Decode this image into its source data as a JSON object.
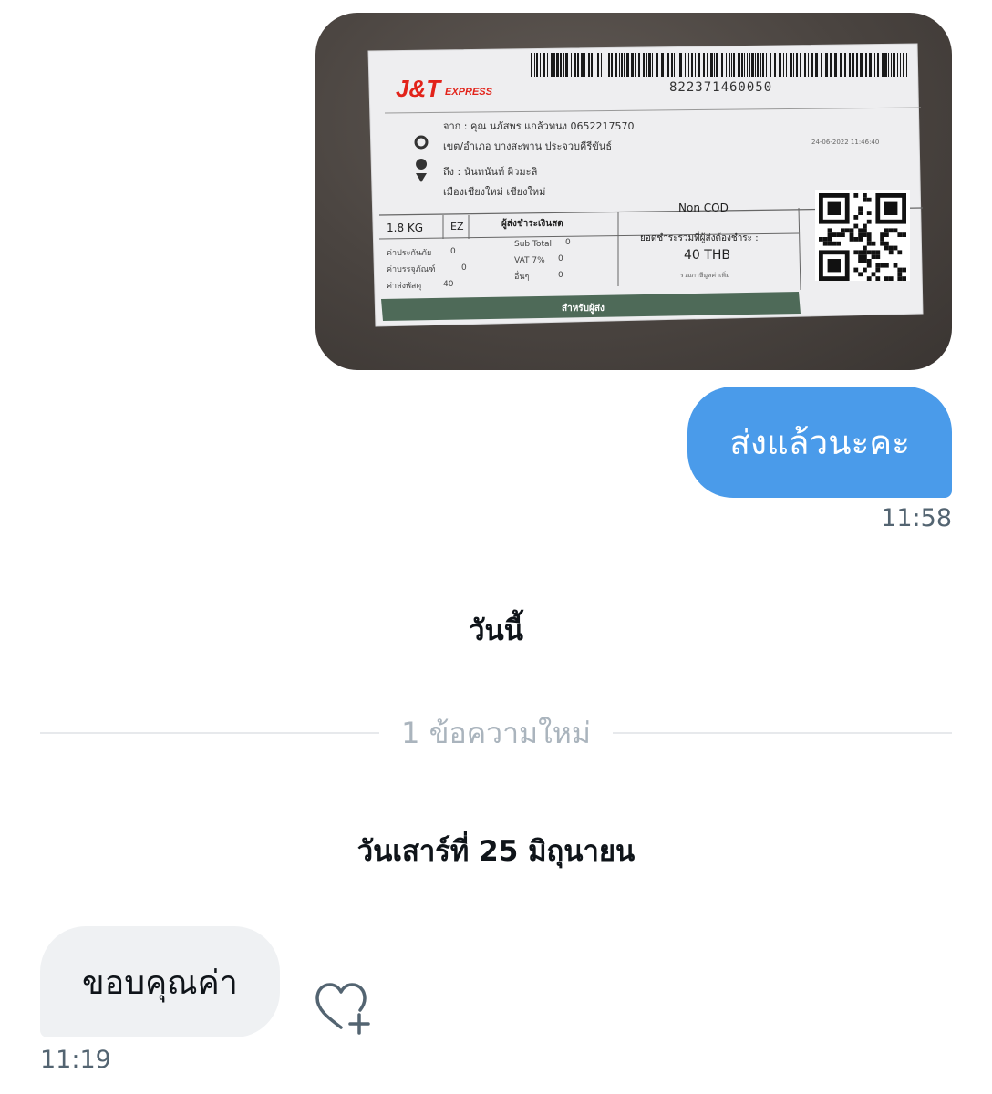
{
  "messages": {
    "outgoing_photo": {
      "label": {
        "brand_main": "J&T",
        "brand_sub": "EXPRESS",
        "tracking": "822371460050",
        "sender_line1": "จาก : คุณ นภัสพร แกล้วทนง 0652217570",
        "sender_line2": "เขต/อำเภอ บางสะพาน ประจวบคีรีขันธ์",
        "receiver_line1": "ถึง : นันทนันท์ ผิวมะลิ",
        "receiver_line2": "เมืองเชียงใหม่ เชียงใหม่",
        "date": "24-06-2022 11:46:40",
        "weight": "1.8 KG",
        "service": "EZ",
        "payer": "ผู้ส่งชำระเงินสด",
        "cod": "Non COD",
        "total_label": "ยอดชำระรวมที่ผู้ส่งต้องชำระ :",
        "total": "40 THB",
        "vat_note": "รวมภาษีมูลค่าเพิ่ม",
        "fee1_label": "ค่าประกันภัย",
        "fee1": "0",
        "fee2_label": "ค่าบรรจุภัณฑ์",
        "fee2": "0",
        "fee3_label": "ค่าส่งพัสดุ",
        "fee3": "40",
        "sub_total_label": "Sub Total",
        "sub_total": "0",
        "vat_label": "VAT 7%",
        "vat": "0",
        "other_label": "อื่นๆ",
        "other": "0",
        "footer": "สำหรับผู้ส่ง"
      }
    },
    "outgoing_text": "ส่งแล้วนะคะ",
    "outgoing_time": "11:58",
    "date_today": "วันนี้",
    "new_messages": "1 ข้อความใหม่",
    "date_saturday": "วันเสาร์ที่ 25 มิถุนายน",
    "incoming_text": "ขอบคุณค่า",
    "incoming_time": "11:19"
  },
  "colors": {
    "outgoing_bubble": "#4a9bea",
    "incoming_bubble": "#eff1f3",
    "jt_red": "#e2231a"
  },
  "icons": {
    "reaction": "heart-plus-icon"
  }
}
